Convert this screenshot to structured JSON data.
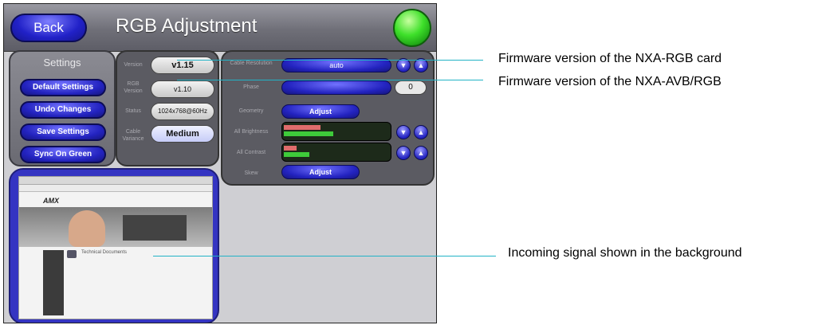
{
  "header": {
    "back_label": "Back",
    "title": "RGB Adjustment"
  },
  "settings": {
    "heading": "Settings",
    "buttons": [
      "Default Settings",
      "Undo Changes",
      "Save Settings",
      "Sync On Green"
    ]
  },
  "info": {
    "version_label": "Version",
    "version_value": "v1.15",
    "rgb_label": "RGB Version",
    "rgb_value": "v1.10",
    "status_label": "Status",
    "status_value": "1024x768@60Hz",
    "cable_label": "Cable Variance",
    "cable_value": "Medium"
  },
  "controls": {
    "resolution_label": "Cable Resolution",
    "resolution_value": "auto",
    "phase_label": "Phase",
    "phase_value": "0",
    "geometry_label": "Geometry",
    "geometry_button": "Adjust",
    "brightness_label": "All Brightness",
    "contrast_label": "All Contrast",
    "skew_label": "Skew",
    "skew_button": "Adjust"
  },
  "preview": {
    "logo": "AMX",
    "heading": "Technical Documents"
  },
  "callouts": [
    "Firmware version of the NXA-RGB card",
    "Firmware version of the NXA-AVB/RGB",
    "Incoming signal shown in the background"
  ],
  "colors": {
    "callout_line": "#22b3c6",
    "button_blue": "#2323c0",
    "status_led": "#3ee02a"
  }
}
